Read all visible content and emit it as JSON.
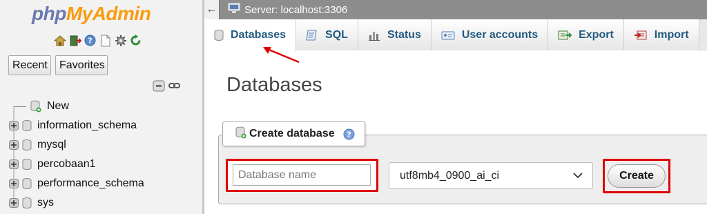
{
  "sidebar": {
    "logo": {
      "part1": "php",
      "part2": "MyAdmin"
    },
    "quick_icons": [
      "home-icon",
      "exit-icon",
      "help-icon",
      "docs-icon",
      "settings-icon",
      "reload-icon"
    ],
    "buttons": {
      "recent": "Recent",
      "favorites": "Favorites"
    },
    "tree": [
      {
        "label": "New",
        "kind": "new"
      },
      {
        "label": "information_schema",
        "kind": "db"
      },
      {
        "label": "mysql",
        "kind": "db"
      },
      {
        "label": "percobaan1",
        "kind": "db"
      },
      {
        "label": "performance_schema",
        "kind": "db"
      },
      {
        "label": "sys",
        "kind": "db"
      }
    ]
  },
  "server_bar": {
    "label": "Server: localhost:3306"
  },
  "tabs": [
    {
      "label": "Databases",
      "icon": "database-icon",
      "active": true
    },
    {
      "label": "SQL",
      "icon": "sql-icon",
      "active": false
    },
    {
      "label": "Status",
      "icon": "status-icon",
      "active": false
    },
    {
      "label": "User accounts",
      "icon": "user-accounts-icon",
      "active": false
    },
    {
      "label": "Export",
      "icon": "export-icon",
      "active": false
    },
    {
      "label": "Import",
      "icon": "import-icon",
      "active": false
    }
  ],
  "main": {
    "title": "Databases",
    "create_db": {
      "legend": "Create database",
      "name_placeholder": "Database name",
      "name_value": "",
      "collation": "utf8mb4_0900_ai_ci",
      "create_label": "Create"
    }
  },
  "colors": {
    "annotation_red": "#e00000",
    "tab_text": "#235a81",
    "logo_php": "#6c78af",
    "logo_myadmin": "#f89c0e"
  }
}
